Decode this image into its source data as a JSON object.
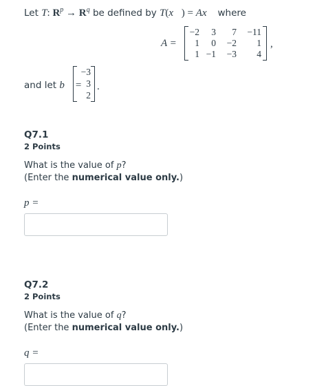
{
  "intro": {
    "prefix": "Let",
    "T": "T",
    "colon": ":",
    "R1": "R",
    "p": "p",
    "arrow": "→",
    "R2": "R",
    "q": "q",
    "middle": "be defined by",
    "Tx": "T",
    "x_vec": "x⃗",
    "eq": "=",
    "A": "A",
    "suffix": "where"
  },
  "matrix_A": {
    "label": "A =",
    "rows": [
      [
        "−2",
        "3",
        "7",
        "−11"
      ],
      [
        "1",
        "0",
        "−2",
        "1"
      ],
      [
        "1",
        "−1",
        "−3",
        "4"
      ]
    ],
    "trailing": ","
  },
  "vector_b": {
    "intro": "and let",
    "name": "b⃗",
    "eq": "=",
    "values": [
      "−3",
      "3",
      "2"
    ],
    "trailing": "."
  },
  "questions": [
    {
      "title": "Q7.1",
      "points": "2 Points",
      "prompt_prefix": "What is the value of ",
      "prompt_var": "p",
      "prompt_suffix": "?",
      "enter_prefix": "(Enter the ",
      "enter_bold": "numerical value only.",
      "enter_suffix": ")",
      "var_label": "p =",
      "answer_value": ""
    },
    {
      "title": "Q7.2",
      "points": "2 Points",
      "prompt_prefix": "What is the value of ",
      "prompt_var": "q",
      "prompt_suffix": "?",
      "enter_prefix": "(Enter the ",
      "enter_bold": "numerical value only.",
      "enter_suffix": ")",
      "var_label": "q =",
      "answer_value": ""
    }
  ]
}
